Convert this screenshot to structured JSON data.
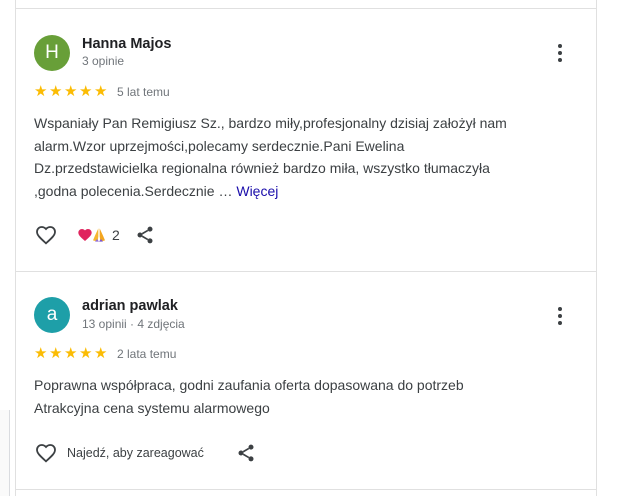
{
  "reviews": [
    {
      "avatar_letter": "H",
      "avatar_color": "#689f38",
      "name": "Hanna Majos",
      "meta": "3 opinie",
      "rating": 5,
      "age": "5 lat temu",
      "text_lines": [
        "Wspaniały Pan Remigiusz Sz., bardzo miły,profesjonalny dzisiaj założył nam",
        "alarm.Wzor uprzejmości,polecamy serdecznie.Pani Ewelina",
        "Dz.przedstawicielka regionalna również bardzo miła, wszystko tłumaczyła",
        ",godna polecenia.Serdecznie … "
      ],
      "more_label": "Więcej",
      "reaction_count": "2"
    },
    {
      "avatar_letter": "a",
      "avatar_color": "#1e9fa8",
      "name": "adrian pawlak",
      "meta": "13 opinii · 4 zdjęcia",
      "rating": 5,
      "age": "2 lata temu",
      "text_lines": [
        "Poprawna współpraca, godni zaufania oferta dopasowana do potrzeb",
        "Atrakcyjna cena systemu alarmowego"
      ],
      "react_hint": "Najedź, aby zareagować"
    }
  ],
  "colors": {
    "star": "#fbbc04",
    "link": "#1a0dab"
  },
  "icons": [
    "heart-outline-icon",
    "share-icon",
    "more-vert-icon",
    "heart-emoji-icon",
    "praying-hands-emoji-icon",
    "star-icon"
  ]
}
